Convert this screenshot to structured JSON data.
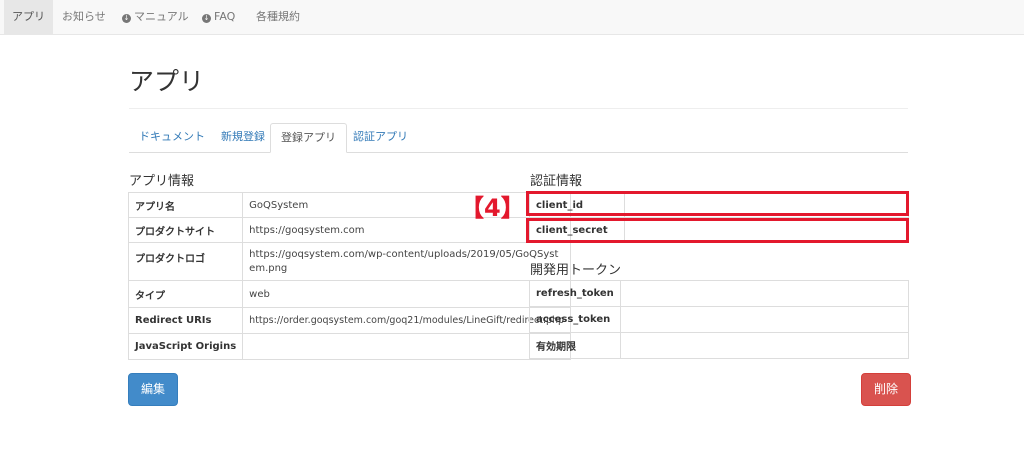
{
  "nav": {
    "items": [
      "アプリ",
      "お知らせ",
      "マニュアル",
      "FAQ",
      "各種規約"
    ]
  },
  "page": {
    "title": "アプリ"
  },
  "tabs": [
    "ドキュメント",
    "新規登録",
    "登録アプリ",
    "認証アプリ"
  ],
  "app_info": {
    "title": "アプリ情報",
    "rows": [
      {
        "key": "アプリ名",
        "value": "GoQSystem"
      },
      {
        "key": "プロダクトサイト",
        "value": "https://goqsystem.com"
      },
      {
        "key": "プロダクトロゴ",
        "value": "https://goqsystem.com/wp-content/uploads/2019/05/GoQSystem.png"
      },
      {
        "key": "タイプ",
        "value": "web"
      },
      {
        "key": "Redirect URIs",
        "value": "https://order.goqsystem.com/goq21/modules/LineGift/redirect.php"
      },
      {
        "key": "JavaScript Origins",
        "value": ""
      }
    ]
  },
  "auth_info": {
    "title": "認証情報",
    "rows": [
      {
        "key": "client_id",
        "value": ""
      },
      {
        "key": "client_secret",
        "value": ""
      }
    ]
  },
  "dev_token": {
    "title": "開発用トークン",
    "rows": [
      {
        "key": "refresh_token",
        "value": ""
      },
      {
        "key": "access_token",
        "value": ""
      },
      {
        "key": "有効期限",
        "value": ""
      }
    ]
  },
  "buttons": {
    "edit": "編集",
    "delete": "削除"
  },
  "annotation": {
    "label": "【4】"
  },
  "colors": {
    "highlight": "#e3182d",
    "primary": "#428bca",
    "danger": "#d9534f"
  }
}
